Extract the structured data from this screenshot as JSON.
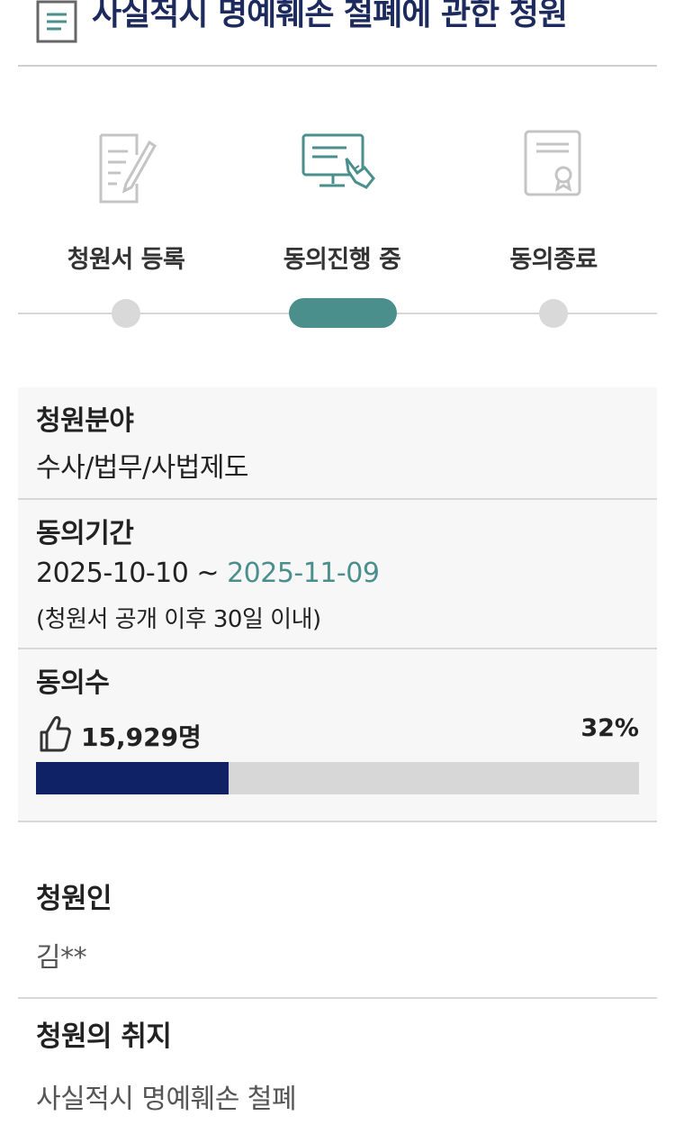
{
  "header": {
    "title": "사실적시 명예훼손 철폐에 관한 청원",
    "icon": "document-list-icon"
  },
  "steps": [
    {
      "label": "청원서 등록",
      "icon": "pen-document-icon",
      "state": "done"
    },
    {
      "label": "동의진행 중",
      "icon": "computer-hand-icon",
      "state": "current"
    },
    {
      "label": "동의종료",
      "icon": "certificate-icon",
      "state": "pending"
    }
  ],
  "info": {
    "category": {
      "label": "청원분야",
      "value": "수사/법무/사법제도"
    },
    "period": {
      "label": "동의기간",
      "start": "2025-10-10",
      "separator": " ~ ",
      "end": "2025-11-09",
      "note": "(청원서 공개 이후 30일 이내)"
    },
    "agree": {
      "label": "동의수",
      "count": "15,929명",
      "percent": "32%",
      "progress": 0.32,
      "icon": "thumbs-up-icon"
    }
  },
  "petitioner": {
    "label": "청원인",
    "value": "김**"
  },
  "purpose": {
    "label": "청원의 취지",
    "value": "사실적시 명예훼손 철폐"
  },
  "colors": {
    "accent": "#4a8f8c",
    "progress": "#102266",
    "title": "#1c2a5e"
  }
}
